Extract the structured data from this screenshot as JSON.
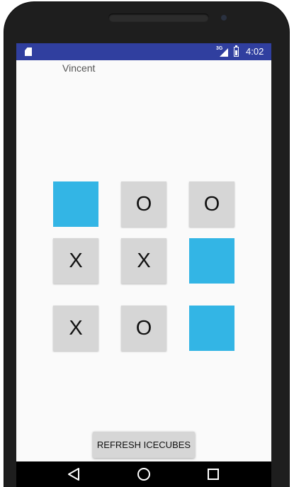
{
  "status_bar": {
    "network_type": "3G",
    "time": "4:02",
    "icons": [
      "sd-card-icon",
      "signal-icon",
      "battery-icon"
    ]
  },
  "player": {
    "name": "Vincent"
  },
  "board": {
    "cells": [
      {
        "mark": "",
        "state": "icecube"
      },
      {
        "mark": "O",
        "state": "marked"
      },
      {
        "mark": "O",
        "state": "marked"
      },
      {
        "mark": "X",
        "state": "marked"
      },
      {
        "mark": "X",
        "state": "marked"
      },
      {
        "mark": "",
        "state": "icecube"
      },
      {
        "mark": "X",
        "state": "marked"
      },
      {
        "mark": "O",
        "state": "marked"
      },
      {
        "mark": "",
        "state": "icecube"
      }
    ],
    "colors": {
      "cell": "#d6d6d6",
      "icecube": "#33b5e5"
    }
  },
  "actions": {
    "refresh_label": "REFRESH ICECUBES"
  },
  "navigation": {
    "icons": [
      "back-icon",
      "home-icon",
      "recents-icon"
    ]
  },
  "colors": {
    "status_bar": "#303f9f",
    "background": "#fafafa"
  }
}
